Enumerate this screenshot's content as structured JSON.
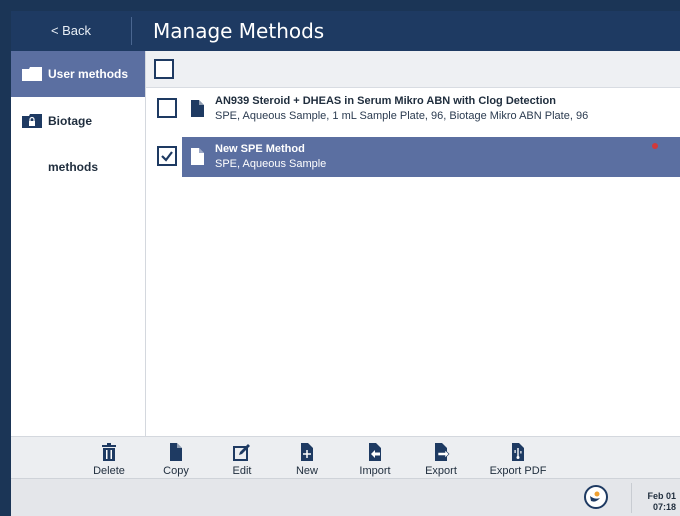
{
  "header": {
    "back_label": "< Back",
    "title": "Manage Methods"
  },
  "sidebar": {
    "items": [
      {
        "label": "User methods",
        "icon": "folder-icon",
        "selected": true
      },
      {
        "label": "Biotage methods",
        "icon": "locked-folder-icon",
        "selected": false
      }
    ]
  },
  "list": {
    "select_all_checked": false,
    "rows": [
      {
        "name": "AN939 Steroid + DHEAS in Serum Mikro ABN with Clog Detection",
        "description": "SPE, Aqueous Sample, 1 mL Sample Plate, 96, Biotage Mikro ABN Plate, 96",
        "checked": false,
        "selected": false
      },
      {
        "name": "New SPE Method",
        "description": "SPE, Aqueous Sample",
        "checked": true,
        "selected": true,
        "unsaved_indicator": true
      }
    ]
  },
  "toolbar": {
    "delete_label": "Delete",
    "copy_label": "Copy",
    "edit_label": "Edit",
    "new_label": "New",
    "import_label": "Import",
    "export_label": "Export",
    "export_pdf_label": "Export PDF"
  },
  "status": {
    "date": "Feb 01",
    "time": "07:18"
  },
  "colors": {
    "header": "#1e3a62",
    "selected": "#5b6fa1",
    "indicator": "#d13a3a"
  }
}
